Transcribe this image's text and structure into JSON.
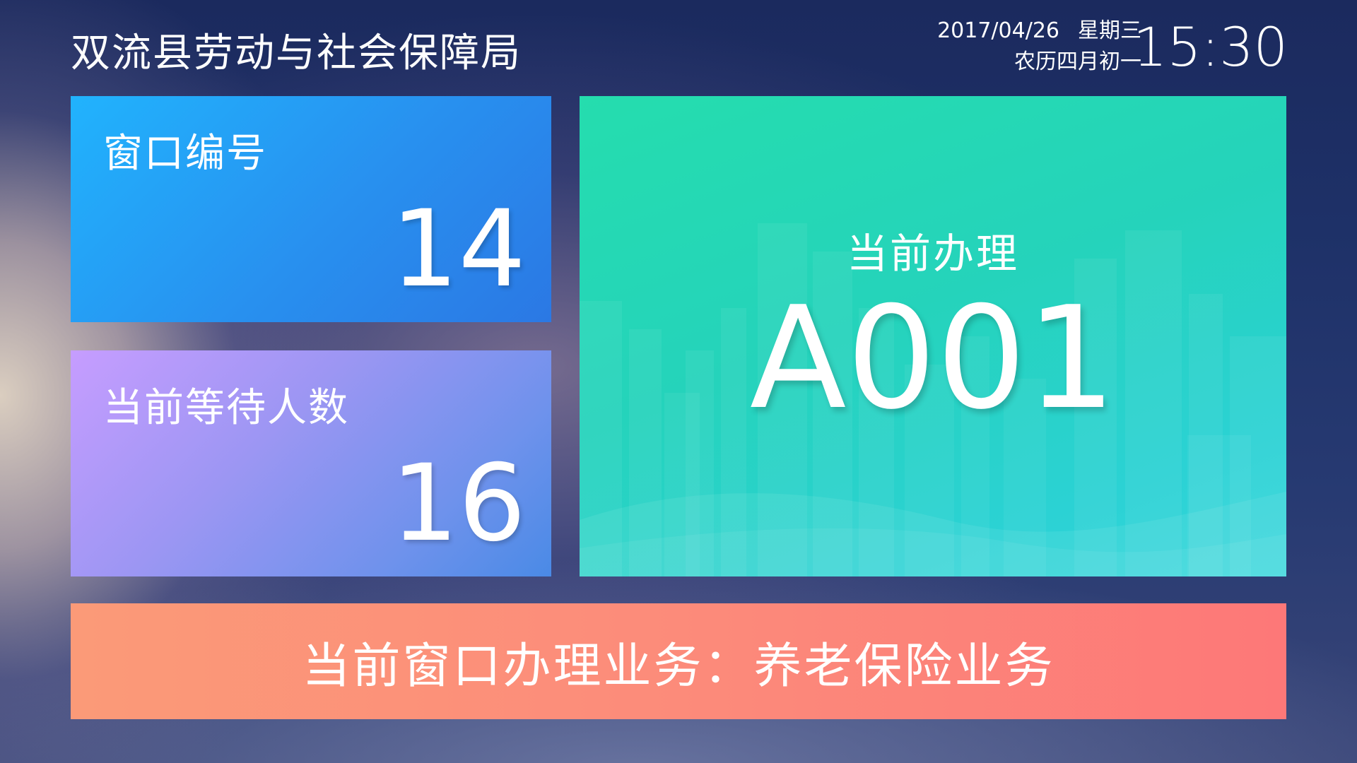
{
  "header": {
    "title": "双流县劳动与社会保障局",
    "date": "2017/04/26",
    "weekday": "星期三",
    "lunar_date": "农历四月初一",
    "time": "15:30"
  },
  "window_panel": {
    "label": "窗口编号",
    "number": "14"
  },
  "waiting_panel": {
    "label": "当前等待人数",
    "number": "16"
  },
  "current_panel": {
    "label": "当前办理",
    "ticket": "A001"
  },
  "service_bar": {
    "text": "当前窗口办理业务：养老保险业务"
  },
  "colors": {
    "window_panel": "#2890ef",
    "waiting_panel": "#9c96f3",
    "current_panel": "#25d3bb",
    "service_bar": "#fc8b7a",
    "background": "#1e3168"
  }
}
